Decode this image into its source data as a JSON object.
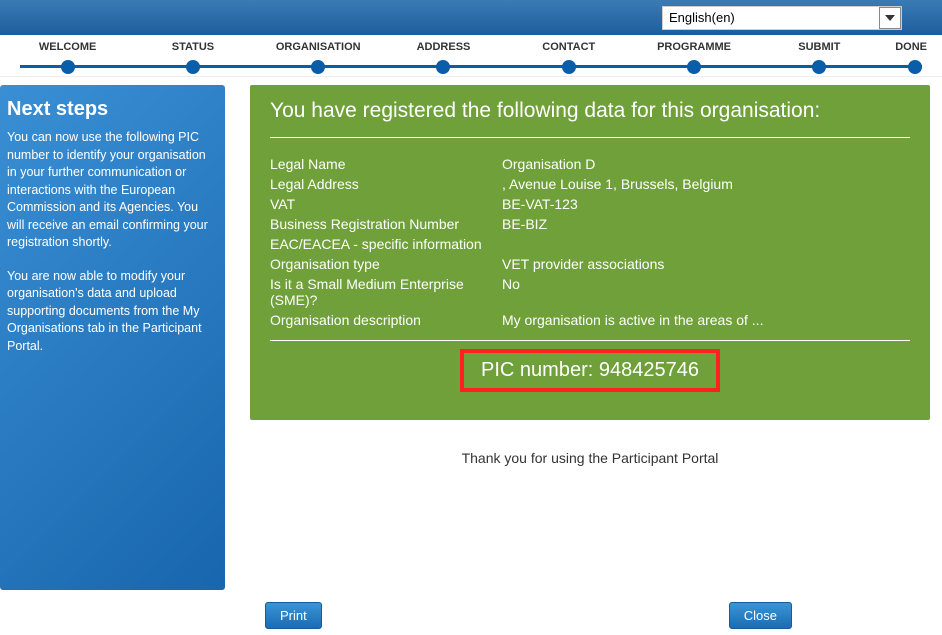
{
  "lang": {
    "selected": "English(en)"
  },
  "steps": [
    "WELCOME",
    "STATUS",
    "ORGANISATION",
    "ADDRESS",
    "CONTACT",
    "PROGRAMME",
    "SUBMIT",
    "DONE"
  ],
  "sidebar": {
    "title": "Next steps",
    "para1": "You can now use the following PIC number to identify your organisation in your further communication or interactions with the European Commission and its Agencies. You will receive an email confirming your registration shortly.",
    "para2": "You are now able to modify your organisation's data and upload supporting documents from the My Organisations tab in the Participant Portal."
  },
  "card": {
    "heading": "You have registered the following data for this organisation:",
    "fields": [
      {
        "label": "Legal Name",
        "value": "Organisation D"
      },
      {
        "label": "Legal Address",
        "value": ", Avenue Louise 1, Brussels, Belgium"
      },
      {
        "label": "VAT",
        "value": "BE-VAT-123"
      },
      {
        "label": "Business Registration Number",
        "value": "BE-BIZ"
      }
    ],
    "subhead": "EAC/EACEA - specific information",
    "fields2": [
      {
        "label": "Organisation type",
        "value": "VET provider associations"
      },
      {
        "label": "Is it a Small Medium Enterprise (SME)?",
        "value": "No"
      },
      {
        "label": "Organisation description",
        "value": "My organisation is active in the areas of ..."
      }
    ],
    "pic_label": "PIC number: ",
    "pic_value": "948425746"
  },
  "thanks": "Thank you for using the Participant Portal",
  "buttons": {
    "print": "Print",
    "close": "Close"
  }
}
